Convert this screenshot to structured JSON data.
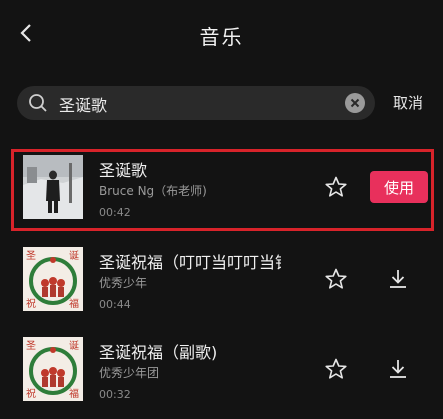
{
  "header": {
    "title": "音乐",
    "back_icon": "back-arrow-icon"
  },
  "search": {
    "query": "圣诞歌",
    "cancel_label": "取消",
    "search_icon": "search-icon",
    "clear_icon": "clear-icon"
  },
  "songs": [
    {
      "title": "圣诞歌",
      "artist": "Bruce Ng（布老师)",
      "duration": "00:42",
      "action_label": "使用",
      "selected": true
    },
    {
      "title": "圣诞祝福（叮叮当叮叮当铃",
      "artist": "优秀少年",
      "duration": "00:44",
      "selected": false
    },
    {
      "title": "圣诞祝福（副歌)",
      "artist": "优秀少年团",
      "duration": "00:32",
      "selected": false
    }
  ],
  "colors": {
    "background": "#131313",
    "accent": "#e8305c",
    "highlight": "#d8232a"
  }
}
